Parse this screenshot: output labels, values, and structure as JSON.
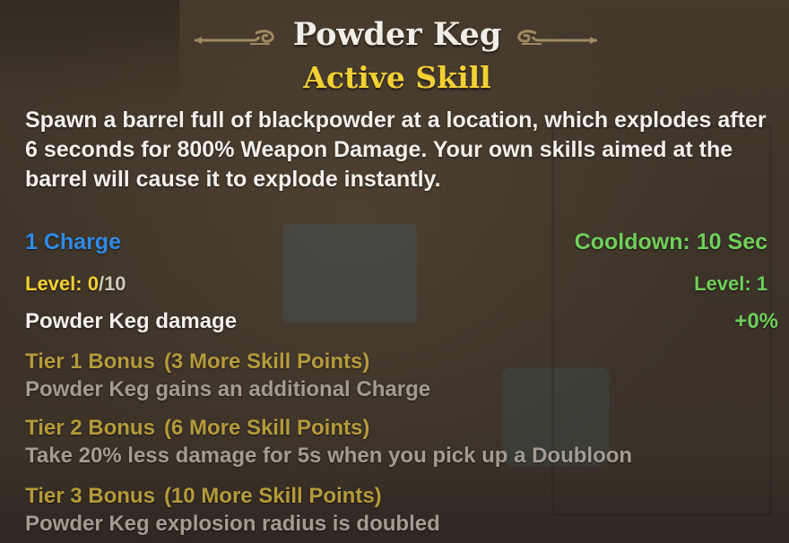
{
  "tooltip": {
    "title": "Powder Keg",
    "subtitle": "Active Skill",
    "description": "Spawn a barrel full of blackpowder at a location, which explodes after 6 seconds for 800% Weapon Damage. Your own skills aimed at the barrel will cause it to explode instantly.",
    "charges": "1 Charge",
    "cooldown": "Cooldown: 10 Sec",
    "level": {
      "label": "Level: ",
      "current": "0",
      "max": "/10",
      "required": "Level: 1"
    },
    "stat": {
      "label": "Powder Keg damage",
      "value": "+0%"
    },
    "tiers": [
      {
        "name": "Tier 1 Bonus",
        "cost": "(3 More Skill Points)",
        "description": "Powder Keg gains an additional Charge"
      },
      {
        "name": "Tier 2 Bonus",
        "cost": "(6 More Skill Points)",
        "description": "Take 20% less damage for 5s when you pick up a Doubloon"
      },
      {
        "name": "Tier 3 Bonus",
        "cost": "(10 More Skill Points)",
        "description": "Powder Keg explosion radius is doubled"
      }
    ],
    "icons": [
      "ornament-left-icon",
      "ornament-right-icon"
    ],
    "colors": {
      "title": "#f1eee6",
      "subtitle": "#f3d033",
      "charges": "#2e8be6",
      "cooldown": "#6fd05a",
      "tier_heading": "#b59a3b",
      "tier_text": "#a39c90",
      "background": "#3d3329"
    }
  }
}
